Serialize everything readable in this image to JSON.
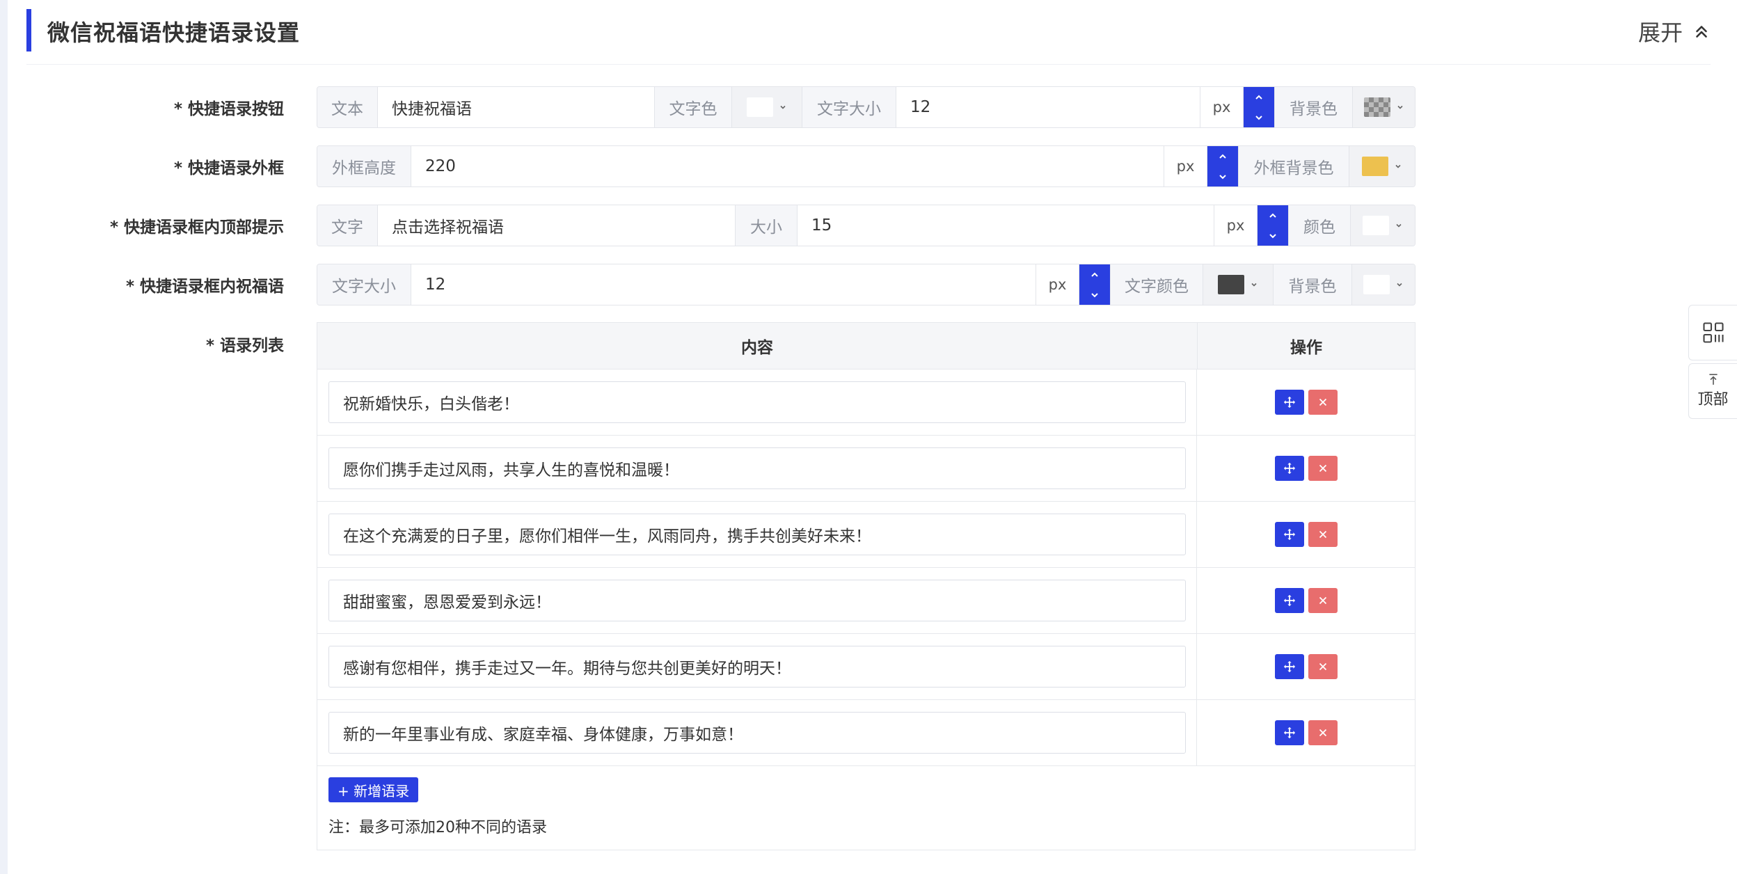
{
  "header": {
    "title": "微信祝福语快捷语录设置",
    "toggle_label": "展开"
  },
  "rows": {
    "button": {
      "label": "* 快捷语录按钮",
      "text_addon": "文本",
      "text_value": "快捷祝福语",
      "text_color_addon": "文字色",
      "text_color": "#ffffff",
      "font_size_addon": "文字大小",
      "font_size_value": "12",
      "unit": "px",
      "bg_addon": "背景色",
      "bg_color": "transparent"
    },
    "frame": {
      "label": "* 快捷语录外框",
      "height_addon": "外框高度",
      "height_value": "220",
      "unit": "px",
      "bg_addon": "外框背景色",
      "bg_color": "#edc14f"
    },
    "top_tip": {
      "label": "* 快捷语录框内顶部提示",
      "text_addon": "文字",
      "text_value": "点击选择祝福语",
      "size_addon": "大小",
      "size_value": "15",
      "unit": "px",
      "color_addon": "颜色",
      "color": "#ffffff"
    },
    "inner_greeting": {
      "label": "* 快捷语录框内祝福语",
      "size_addon": "文字大小",
      "size_value": "12",
      "unit": "px",
      "text_color_addon": "文字颜色",
      "text_color": "#444444",
      "bg_addon": "背景色",
      "bg_color": "#ffffff"
    }
  },
  "phrase_list": {
    "label": "* 语录列表",
    "col_content": "内容",
    "col_action": "操作",
    "items": [
      "祝新婚快乐，白头偕老！",
      "愿你们携手走过风雨，共享人生的喜悦和温暖！",
      "在这个充满爱的日子里，愿你们相伴一生，风雨同舟，携手共创美好未来！",
      "甜甜蜜蜜，恩恩爱爱到永远！",
      "感谢有您相伴，携手走过又一年。期待与您共创更美好的明天！",
      "新的一年里事业有成、家庭幸福、身体健康，万事如意！"
    ],
    "add_label": "+ 新增语录",
    "note": "注：最多可添加20种不同的语录"
  },
  "side": {
    "qr_icon": "qrcode-icon",
    "top_label": "顶部"
  },
  "colors": {
    "accent": "#2a3fe0",
    "danger": "#e86d6d"
  }
}
